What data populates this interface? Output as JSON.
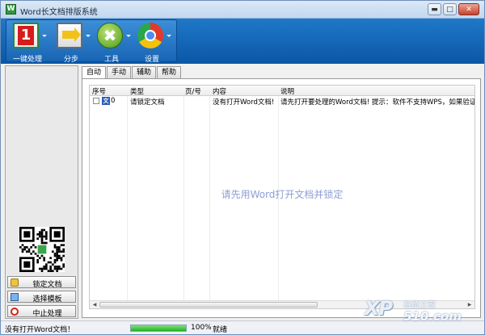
{
  "window": {
    "title": "Word长文档排版系统",
    "app_icon": "W",
    "minimize_glyph": "▬",
    "maximize_glyph": "□",
    "close_glyph": "✕"
  },
  "toolbar": {
    "one_click": {
      "label": "一键处理",
      "icon": "one-click-icon",
      "glyph": "1"
    },
    "step": {
      "label": "分步",
      "icon": "arrow-step-icon"
    },
    "tools": {
      "label": "工具",
      "icon": "tools-icon",
      "glyph": "✖"
    },
    "settings": {
      "label": "设置",
      "icon": "settings-icon"
    }
  },
  "sidebar": {
    "buttons": [
      {
        "label": "锁定文档",
        "icon": "lock-icon"
      },
      {
        "label": "选择模板",
        "icon": "template-icon"
      },
      {
        "label": "中止处理",
        "icon": "stop-icon"
      }
    ]
  },
  "tabs": [
    {
      "label": "自动",
      "active": true
    },
    {
      "label": "手动",
      "active": false
    },
    {
      "label": "辅助",
      "active": false
    },
    {
      "label": "帮助",
      "active": false
    }
  ],
  "table": {
    "columns": [
      "序号",
      "类型",
      "页/号",
      "内容",
      "说明"
    ],
    "rows": [
      {
        "index": "0",
        "type": "请锁定文档",
        "page": "",
        "content": "没有打开Word文档!",
        "note": "请先打开要处理的Word文档! 提示：软件不支持WPS，如果验证失"
      }
    ],
    "empty_message": "请先用Word打开文档并锁定",
    "scroll_left": "◀",
    "scroll_right": "▶"
  },
  "statusbar": {
    "message": "没有打开Word文档！",
    "progress": 100,
    "progress_text": "100%",
    "state": "就绪"
  },
  "watermark": {
    "big": "XP",
    "small": "系统之家",
    "num": "510.com"
  },
  "colors": {
    "toolbar_blue": "#0b56a6",
    "empty_message": "#8d9ed6",
    "progress_green": "#21b221"
  }
}
